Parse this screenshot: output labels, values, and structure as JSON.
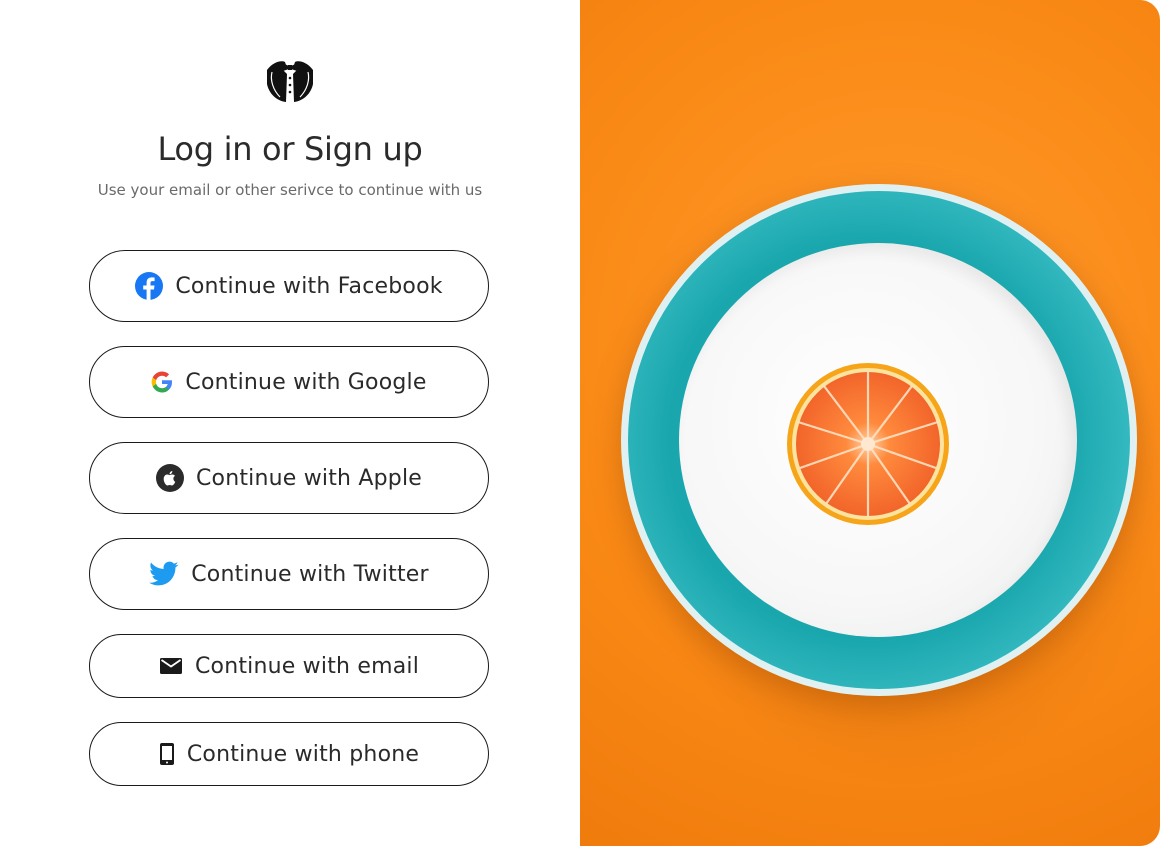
{
  "auth": {
    "title": "Log in or Sign up",
    "subtitle": "Use your email or other serivce to continue with us",
    "buttons": [
      {
        "label": "Continue with Facebook",
        "icon": "facebook-icon"
      },
      {
        "label": "Continue with Google",
        "icon": "google-icon"
      },
      {
        "label": "Continue with Apple",
        "icon": "apple-icon"
      },
      {
        "label": "Continue with Twitter",
        "icon": "twitter-icon"
      },
      {
        "label": "Continue with email",
        "icon": "mail-icon"
      },
      {
        "label": "Continue with phone",
        "icon": "phone-icon"
      }
    ]
  },
  "colors": {
    "accent_orange": "#fa8a16",
    "facebook_blue": "#1877f2",
    "twitter_blue": "#1d9bf0",
    "plate_teal": "#19a6ad"
  }
}
